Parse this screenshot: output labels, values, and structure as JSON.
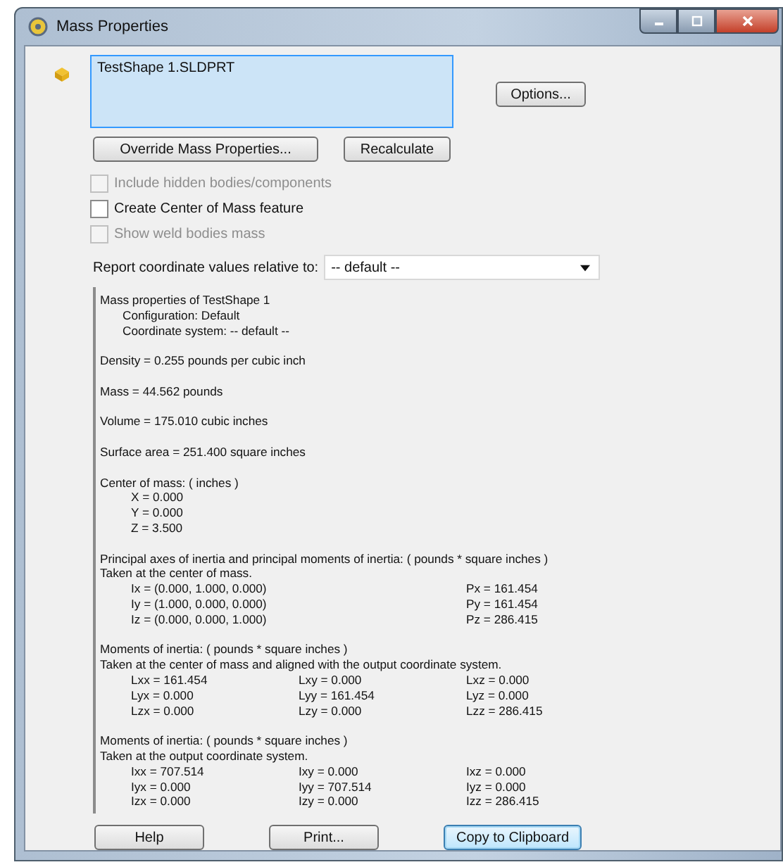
{
  "window": {
    "title": "Mass Properties"
  },
  "selection": {
    "value": "TestShape 1.SLDPRT"
  },
  "options_button": "Options...",
  "action_buttons": [
    "Override Mass Properties...",
    "Recalculate"
  ],
  "checkboxes": [
    {
      "label": "Include hidden bodies/components",
      "checked": false,
      "disabled": true
    },
    {
      "label": "Create Center of Mass feature",
      "checked": false,
      "disabled": false
    },
    {
      "label": "Show weld bodies mass",
      "checked": false,
      "disabled": true
    }
  ],
  "coordinate_system": {
    "label": "Report coordinate values relative to:",
    "value": "-- default --"
  },
  "results": [
    {
      "kind": "text",
      "text": "Mass properties of TestShape 1"
    },
    {
      "kind": "sub",
      "text": "Configuration: Default"
    },
    {
      "kind": "sub",
      "text": "Coordinate system: -- default --"
    },
    {
      "kind": "gap"
    },
    {
      "kind": "text",
      "text": "Density = 0.255 pounds per cubic inch"
    },
    {
      "kind": "gap"
    },
    {
      "kind": "text",
      "text": "Mass = 44.562 pounds"
    },
    {
      "kind": "gap"
    },
    {
      "kind": "text",
      "text": "Volume = 175.010 cubic inches"
    },
    {
      "kind": "gap"
    },
    {
      "kind": "text",
      "text": "Surface area = 251.400 square inches"
    },
    {
      "kind": "gap"
    },
    {
      "kind": "text",
      "text": "Center of mass: ( inches )"
    },
    {
      "kind": "row",
      "cells": [
        "X = 0.000"
      ]
    },
    {
      "kind": "row",
      "cells": [
        "Y = 0.000"
      ]
    },
    {
      "kind": "row",
      "cells": [
        "Z = 3.500"
      ]
    },
    {
      "kind": "gap"
    },
    {
      "kind": "text",
      "text": "Principal axes of inertia and principal moments of inertia: ( pounds * square inches )"
    },
    {
      "kind": "text",
      "text": "Taken at the center of mass."
    },
    {
      "kind": "pair",
      "cells": [
        "Ix = (0.000, 1.000, 0.000)",
        "Px = 161.454"
      ]
    },
    {
      "kind": "pair",
      "cells": [
        "Iy = (1.000, 0.000, 0.000)",
        "Py = 161.454"
      ]
    },
    {
      "kind": "pair",
      "cells": [
        "Iz = (0.000, 0.000, 1.000)",
        "Pz = 286.415"
      ]
    },
    {
      "kind": "gap"
    },
    {
      "kind": "text",
      "text": "Moments of inertia: ( pounds * square inches )"
    },
    {
      "kind": "text",
      "text": "Taken at the center of mass and aligned with the output coordinate system."
    },
    {
      "kind": "row",
      "cells": [
        "Lxx = 161.454",
        "Lxy = 0.000",
        "Lxz = 0.000"
      ]
    },
    {
      "kind": "row",
      "cells": [
        "Lyx = 0.000",
        "Lyy = 161.454",
        "Lyz = 0.000"
      ]
    },
    {
      "kind": "row",
      "cells": [
        "Lzx = 0.000",
        "Lzy = 0.000",
        "Lzz = 286.415"
      ]
    },
    {
      "kind": "gap"
    },
    {
      "kind": "text",
      "text": "Moments of inertia: ( pounds * square inches )"
    },
    {
      "kind": "text",
      "text": "Taken at the output coordinate system."
    },
    {
      "kind": "row",
      "cells": [
        "Ixx = 707.514",
        "Ixy = 0.000",
        "Ixz = 0.000"
      ]
    },
    {
      "kind": "row",
      "cells": [
        "Iyx = 0.000",
        "Iyy = 707.514",
        "Iyz = 0.000"
      ]
    },
    {
      "kind": "row",
      "cells": [
        "Izx = 0.000",
        "Izy = 0.000",
        "Izz = 286.415"
      ]
    }
  ],
  "bottom_buttons": [
    {
      "label": "Help",
      "focused": false
    },
    {
      "label": "Print...",
      "focused": false
    },
    {
      "label": "Copy to Clipboard",
      "focused": true
    }
  ]
}
